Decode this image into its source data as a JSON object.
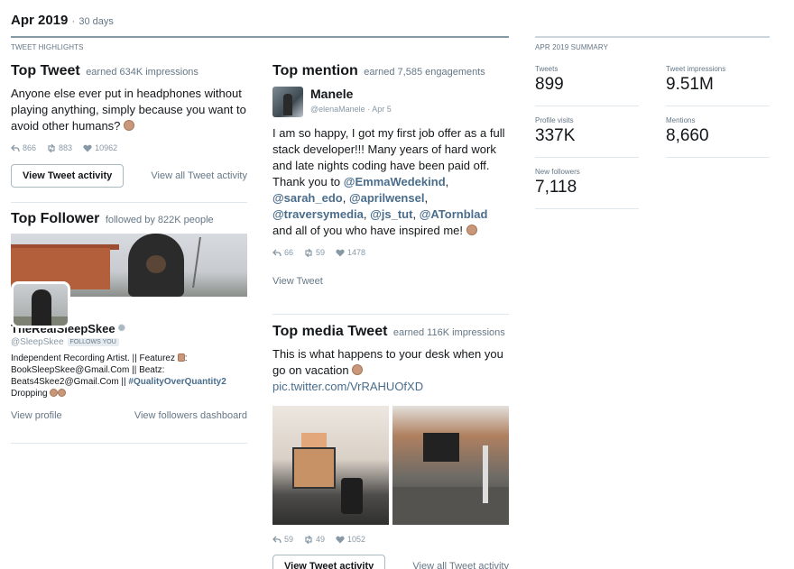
{
  "header": {
    "period": "Apr 2019",
    "separator": "·",
    "days": "30 days"
  },
  "highlights_label": "TWEET HIGHLIGHTS",
  "summary_label": "APR 2019 SUMMARY",
  "top_tweet": {
    "title": "Top Tweet",
    "subtitle": "earned 634K impressions",
    "text": "Anyone else ever put in headphones without playing anything, simply because you want to avoid other humans?",
    "replies": "866",
    "retweets": "883",
    "likes": "10962",
    "button": "View Tweet activity",
    "link": "View all Tweet activity"
  },
  "top_follower": {
    "title": "Top Follower",
    "subtitle": "followed by 822K people",
    "name": "TheRealSleepSkee",
    "handle": "@SleepSkee",
    "follows_badge": "FOLLOWS YOU",
    "bio_1": "Independent Recording Artist. || Featurez",
    "bio_2": ": BookSleepSkee@Gmail.Com || Beatz: Beats4Skee2@Gmail.Com ||",
    "bio_hashtag": "#QualityOverQuantity2",
    "bio_3": "Dropping",
    "view_profile": "View profile",
    "followers_dashboard": "View followers dashboard"
  },
  "top_mention": {
    "title": "Top mention",
    "subtitle": "earned 7,585 engagements",
    "author_name": "Manele",
    "author_handle": "@elenaManele",
    "date": "Apr 5",
    "text_1": "I am so happy, I got my first job offer as a full stack developer!!!  Many years of hard work and late nights coding have been paid off. Thank you to",
    "mention_1": "@EmmaWedekind",
    "mention_2": "@sarah_edo",
    "mention_3": "@aprilwensel",
    "mention_4": "@traversymedia",
    "mention_5": "@js_tut",
    "mention_6": "@ATornblad",
    "text_2": "and all of you who have inspired me!",
    "replies": "66",
    "retweets": "59",
    "likes": "1478",
    "view_link": "View Tweet"
  },
  "top_media": {
    "title": "Top media Tweet",
    "subtitle": "earned 116K impressions",
    "text": "This is what happens to your desk when you go on vacation",
    "pic_link": "pic.twitter.com/VrRAHUOfXD",
    "replies": "59",
    "retweets": "49",
    "likes": "1052",
    "button": "View Tweet activity",
    "link": "View all Tweet activity"
  },
  "summary": {
    "tweets_label": "Tweets",
    "tweets_value": "899",
    "impressions_label": "Tweet impressions",
    "impressions_value": "9.51M",
    "visits_label": "Profile visits",
    "visits_value": "337K",
    "mentions_label": "Mentions",
    "mentions_value": "8,660",
    "followers_label": "New followers",
    "followers_value": "7,118"
  },
  "colors": {
    "link": "#4a6d8c",
    "muted": "#657786",
    "rule": "#8899a6"
  }
}
